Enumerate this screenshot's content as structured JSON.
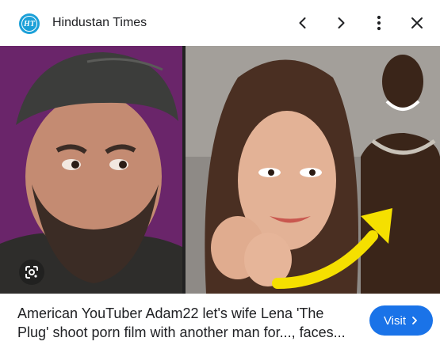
{
  "header": {
    "source_name": "Hindustan Times",
    "logo_text": "HT",
    "icons": [
      "hindustan-times-logo",
      "chevron-left-icon",
      "chevron-right-icon",
      "more-vert-icon",
      "close-icon"
    ]
  },
  "image": {
    "icons": [
      "google-lens-icon"
    ]
  },
  "article": {
    "headline": "American YouTuber Adam22 let's wife Lena 'The Plug' shoot porn film with another man for..., faces..."
  },
  "visit_button": {
    "label": "Visit",
    "icon": "chevron-right-icon"
  },
  "colors": {
    "accent": "#1a73e8",
    "logo_bg": "#1ba0d8",
    "text": "#202124"
  }
}
